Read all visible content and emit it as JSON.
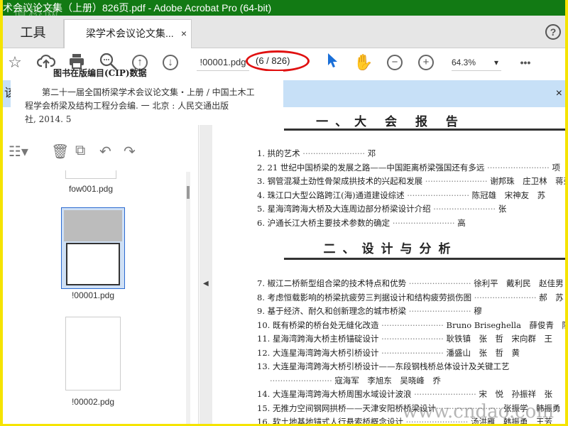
{
  "window": {
    "title": "术会议论文集（上册）826页.pdf - Adobe Acrobat Pro (64-bit)",
    "watermark": "道桥网"
  },
  "tabs": {
    "tools": "工具",
    "document": "梁学术会议论文集...",
    "close": "×",
    "help": "?"
  },
  "toolbar": {
    "page_field": "!00001.pdg",
    "page_count": "(6 / 826)",
    "zoom": "64.3%",
    "more": "•••"
  },
  "notice": {
    "text": "该",
    "close": "×"
  },
  "popup": {
    "heading": "图书在版编目(CIP)数据",
    "lines": [
      "第二十一届全国桥梁学术会议论文集・上册 / 中国土木工",
      "程学会桥梁及结构工程分会编. 一 北京 : 人民交通出版",
      "社, 2014. 5"
    ]
  },
  "thumbnails": [
    {
      "label": "fow001.pdg"
    },
    {
      "label": "!00001.pdg",
      "selected": true
    },
    {
      "label": "!00002.pdg"
    }
  ],
  "document": {
    "sections": [
      "一、大 会 报 告",
      "二、设计与分析"
    ],
    "entries1": [
      {
        "title": "1. 拱的艺术",
        "authors": "邓"
      },
      {
        "title": "2. 21 世纪中国桥梁的发展之路——中国距离桥梁强国还有多远",
        "authors": "项"
      },
      {
        "title": "3. 钢管混凝土劲性骨架成拱技术的兴起和发展",
        "authors": "谢邦珠　庄卫林　蒋劲松　牟"
      },
      {
        "title": "4. 珠江口大型公路跨江(海)通道建设综述",
        "authors": "陈冠雄　宋神友　苏"
      },
      {
        "title": "5. 星海湾跨海大桥及大连周边部分桥梁设计介绍",
        "authors": "张"
      },
      {
        "title": "6. 沪通长江大桥主要技术参数的确定",
        "authors": "高"
      }
    ],
    "entries2": [
      {
        "title": "7. 椒江二桥新型组合梁的技术特点和优势",
        "authors": "徐利平　戴利民　赵佳男　郭"
      },
      {
        "title": "8. 考虑恒载影响的桥梁抗疲劳三判据设计和结构疲劳损伤图",
        "authors": "郝　苏　陈"
      },
      {
        "title": "9. 基于经济、耐久和创新理念的城市桥梁",
        "authors": "穆"
      },
      {
        "title": "10. 既有桥梁的桥台处无缝化改造",
        "authors": "Bruno Briseghella　薛俊青　陈宝春　庄"
      },
      {
        "title": "11. 星海湾跨海大桥主桥锚碇设计",
        "authors": "耿铁镇　张　哲　宋向群　王"
      },
      {
        "title": "12. 大连星海湾跨海大桥引桥设计",
        "authors": "潘盛山　张　哲　黄"
      },
      {
        "title": "13. 大连星海湾跨海大桥引桥设计——东段钢栈桥总体设计及关键工艺",
        "authors": ""
      },
      {
        "title": "",
        "authors": "寇海军　李旭东　吴晓峰　乔"
      },
      {
        "title": "14. 大连星海湾跨海大桥周围水域设计波浪",
        "authors": "宋　悦　孙振祥　张"
      },
      {
        "title": "15. 无推力空间钢网拱桥——天津安阳桥桥梁设计",
        "authors": "张振学　韩振勇　郭会"
      },
      {
        "title": "16. 软土地基地锚式人行悬索桥概念设计",
        "authors": "汤洪雁　韩振勇　王芳"
      }
    ],
    "watermark": "www.cndao.com"
  },
  "colors": {
    "titlebar": "#127a14",
    "frame": "#f5e400",
    "notice": "#c7e0f7",
    "highlight_oval": "#e01010",
    "cursor": "#1a6fd8"
  }
}
